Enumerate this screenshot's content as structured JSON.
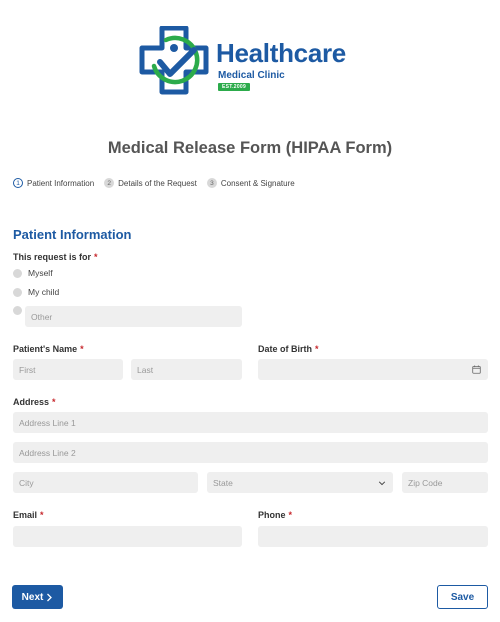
{
  "brand": {
    "name": "Healthcare",
    "subtitle": "Medical Clinic",
    "est": "EST.2009",
    "primary_color": "#1d5aa3",
    "accent_color": "#2cab4b"
  },
  "form": {
    "title": "Medical Release Form (HIPAA Form)",
    "steps": [
      {
        "num": "1",
        "label": "Patient Information",
        "active": true
      },
      {
        "num": "2",
        "label": "Details of the Request",
        "active": false
      },
      {
        "num": "3",
        "label": "Consent & Signature",
        "active": false
      }
    ],
    "section_title": "Patient Information",
    "request_for": {
      "label": "This request is for",
      "options": [
        "Myself",
        "My child"
      ],
      "other_placeholder": "Other"
    },
    "patient_name": {
      "label": "Patient's Name",
      "first_placeholder": "First",
      "last_placeholder": "Last"
    },
    "dob": {
      "label": "Date of Birth"
    },
    "address": {
      "label": "Address",
      "line1_placeholder": "Address Line 1",
      "line2_placeholder": "Address Line 2",
      "city_placeholder": "City",
      "state_placeholder": "State",
      "zip_placeholder": "Zip Code"
    },
    "email": {
      "label": "Email"
    },
    "phone": {
      "label": "Phone"
    },
    "required_mark": "*"
  },
  "buttons": {
    "next": "Next",
    "save": "Save"
  }
}
